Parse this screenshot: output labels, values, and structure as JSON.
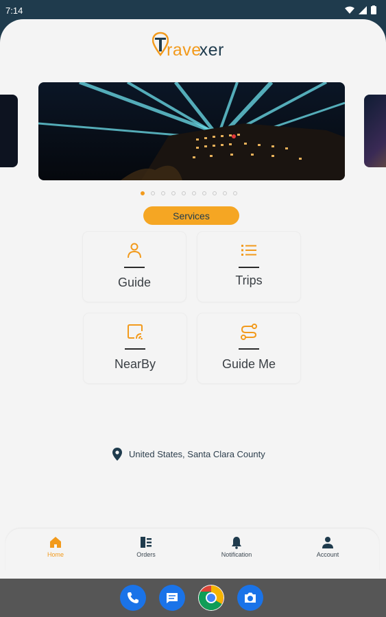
{
  "status_bar": {
    "time": "7:14"
  },
  "app": {
    "logo": {
      "mark": "T",
      "text_orange": "rave",
      "text_navy": "xer"
    },
    "carousel": {
      "total_slides": 10,
      "active_index": 0
    },
    "section_title": "Services",
    "services": [
      {
        "label": "Guide",
        "icon": "person-icon"
      },
      {
        "label": "Trips",
        "icon": "list-icon"
      },
      {
        "label": "NearBy",
        "icon": "nearby-icon"
      },
      {
        "label": "Guide Me",
        "icon": "route-icon"
      }
    ],
    "location": "United States, Santa Clara County"
  },
  "bottom_nav": [
    {
      "label": "Home",
      "icon": "home-icon",
      "active": true
    },
    {
      "label": "Orders",
      "icon": "orders-icon",
      "active": false
    },
    {
      "label": "Notification",
      "icon": "bell-icon",
      "active": false
    },
    {
      "label": "Account",
      "icon": "account-icon",
      "active": false
    }
  ],
  "system_dock": [
    {
      "name": "phone-app-icon",
      "color": "#1a73e8"
    },
    {
      "name": "messages-app-icon",
      "color": "#1a73e8"
    },
    {
      "name": "chrome-app-icon",
      "color": "#ffffff"
    },
    {
      "name": "camera-app-icon",
      "color": "#1a73e8"
    }
  ],
  "colors": {
    "accent": "#f29a1c",
    "services_pill": "#f5a623",
    "navy": "#1f3b4d",
    "background": "#f4f4f4"
  }
}
